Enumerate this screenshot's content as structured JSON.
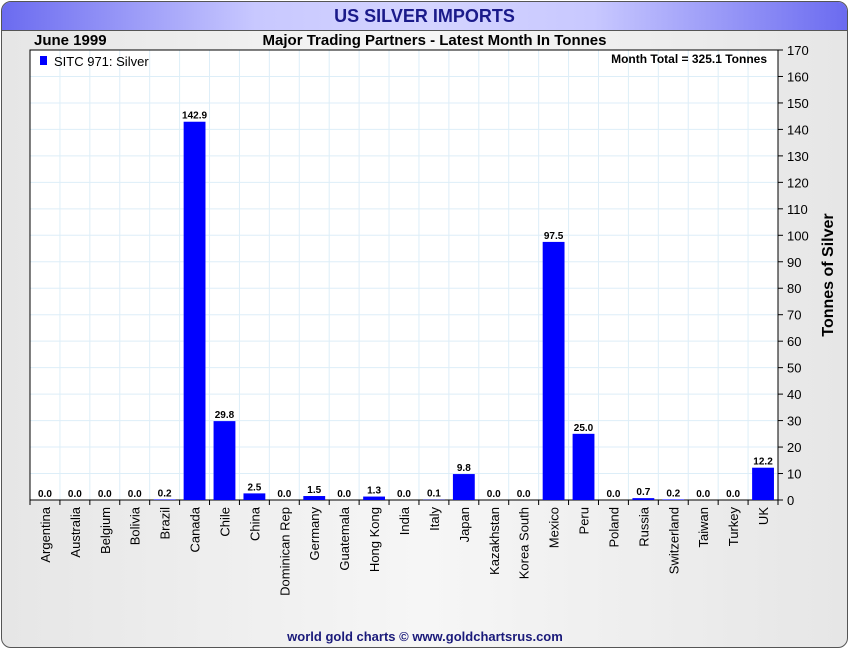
{
  "title": "US SILVER IMPORTS",
  "period": "June 1999",
  "footer": "world gold charts © www.goldchartsrus.com",
  "chart_data": {
    "type": "bar",
    "title": "Major Trading Partners - Latest Month In Tonnes",
    "ylabel": "Tonnes of Silver",
    "xlabel": "",
    "ylim": [
      0,
      170
    ],
    "yticks": [
      0,
      10,
      20,
      30,
      40,
      50,
      60,
      70,
      80,
      90,
      100,
      110,
      120,
      130,
      140,
      150,
      160,
      170
    ],
    "legend": {
      "label": "SITC 971: Silver",
      "placement": "top-left"
    },
    "annotation": "Month Total = 325.1 Tonnes",
    "bar_color": "#0000ff",
    "grid": true,
    "categories": [
      "Argentina",
      "Australia",
      "Belgium",
      "Bolivia",
      "Brazil",
      "Canada",
      "Chile",
      "China",
      "Dominican Rep",
      "Germany",
      "Guatemala",
      "Hong Kong",
      "India",
      "Italy",
      "Japan",
      "Kazakhstan",
      "Korea South",
      "Mexico",
      "Peru",
      "Poland",
      "Russia",
      "Switzerland",
      "Taiwan",
      "Turkey",
      "UK"
    ],
    "values": [
      0.0,
      0.0,
      0.0,
      0.0,
      0.2,
      142.9,
      29.8,
      2.5,
      0.0,
      1.5,
      0.0,
      1.3,
      0.0,
      0.1,
      9.8,
      0.0,
      0.0,
      97.5,
      25.0,
      0.0,
      0.7,
      0.2,
      0.0,
      0.0,
      12.2
    ]
  }
}
